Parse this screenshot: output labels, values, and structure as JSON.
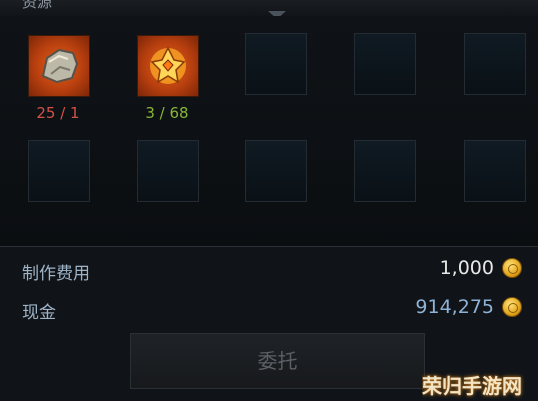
{
  "header": {
    "title": "资源"
  },
  "materials": [
    {
      "icon": "ore-rock-icon",
      "owned_required": "25 / 1",
      "status_color": "#d35149"
    },
    {
      "icon": "flame-gem-icon",
      "owned_required": "3 / 68",
      "status_color": "#87b53a"
    }
  ],
  "costs": {
    "craft_fee_label": "制作费用",
    "craft_fee_value": "1,000",
    "cash_label": "现金",
    "cash_value": "914,275",
    "currency_icon": "gold-coin-icon"
  },
  "commit_button": {
    "label": "委托",
    "state": "disabled"
  },
  "watermark": {
    "text": "荣归手游网"
  },
  "colors": {
    "insufficient": "#d35149",
    "sufficient": "#87b53a",
    "cash": "#8fb3d6"
  }
}
